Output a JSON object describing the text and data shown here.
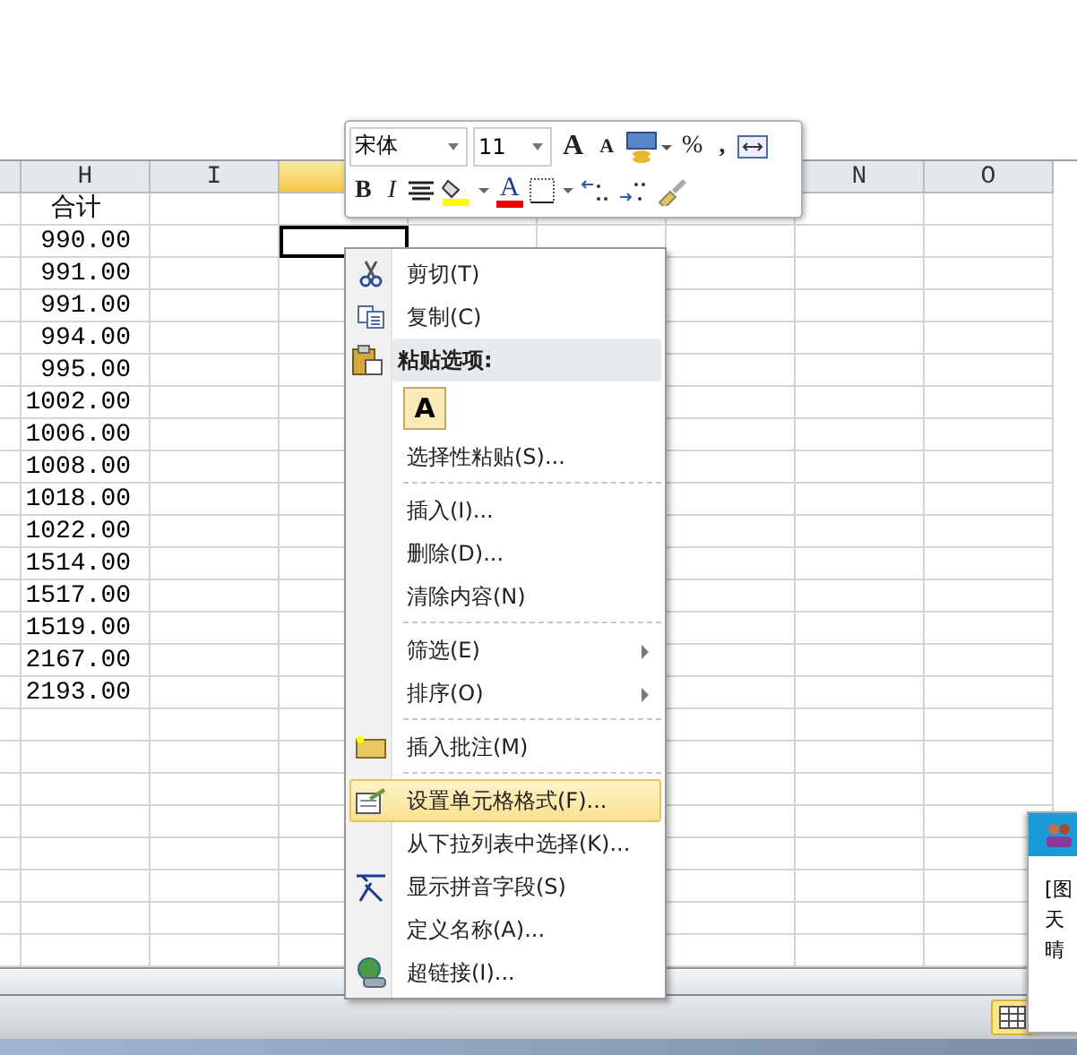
{
  "columns": [
    {
      "label": "H",
      "selected": false
    },
    {
      "label": "I",
      "selected": false
    },
    {
      "selected": true
    },
    {
      "label": "N",
      "selected": false
    },
    {
      "label": "O",
      "selected": false
    }
  ],
  "rows": [
    {
      "h": "合计",
      "selected": false
    },
    {
      "h": "990.00",
      "selected": true
    },
    {
      "h": "991.00",
      "selected": false
    },
    {
      "h": "991.00",
      "selected": false
    },
    {
      "h": "994.00",
      "selected": false
    },
    {
      "h": "995.00",
      "selected": false
    },
    {
      "h": "1002.00",
      "selected": false
    },
    {
      "h": "1006.00",
      "selected": false
    },
    {
      "h": "1008.00",
      "selected": false
    },
    {
      "h": "1018.00",
      "selected": false
    },
    {
      "h": "1022.00",
      "selected": false
    },
    {
      "h": "1514.00",
      "selected": false
    },
    {
      "h": "1517.00",
      "selected": false
    },
    {
      "h": "1519.00",
      "selected": false
    },
    {
      "h": "2167.00",
      "selected": false
    },
    {
      "h": "2193.00",
      "selected": false
    }
  ],
  "mini_toolbar": {
    "font_name": "宋体",
    "font_size": "11",
    "grow_label": "A",
    "shrink_label": "A",
    "percent_label": "%",
    "comma_label": ",",
    "bold_label": "B",
    "italic_label": "I",
    "font_color_label": "A"
  },
  "context_menu": [
    {
      "kind": "item",
      "label": "剪切(T)",
      "submenu": false,
      "selected": false
    },
    {
      "kind": "item",
      "label": "复制(C)",
      "submenu": false,
      "selected": false
    },
    {
      "kind": "header",
      "label": "粘贴选项:"
    },
    {
      "kind": "paste",
      "label": "A"
    },
    {
      "kind": "item",
      "label": "选择性粘贴(S)...",
      "submenu": false,
      "selected": false,
      "separator": true
    },
    {
      "kind": "item",
      "label": "插入(I)...",
      "submenu": false,
      "selected": false
    },
    {
      "kind": "item",
      "label": "删除(D)...",
      "submenu": false,
      "selected": false
    },
    {
      "kind": "item",
      "label": "清除内容(N)",
      "submenu": false,
      "selected": false,
      "separator": true
    },
    {
      "kind": "item",
      "label": "筛选(E)",
      "submenu": true,
      "selected": false
    },
    {
      "kind": "item",
      "label": "排序(O)",
      "submenu": true,
      "selected": false,
      "separator": true
    },
    {
      "kind": "item",
      "label": "插入批注(M)",
      "submenu": false,
      "selected": false,
      "separator": true
    },
    {
      "kind": "item",
      "label": "设置单元格格式(F)...",
      "submenu": false,
      "selected": true
    },
    {
      "kind": "item",
      "label": "从下拉列表中选择(K)...",
      "submenu": false,
      "selected": false
    },
    {
      "kind": "item",
      "label": "显示拼音字段(S)",
      "submenu": false,
      "selected": false
    },
    {
      "kind": "item",
      "label": "定义名称(A)...",
      "submenu": false,
      "selected": false
    },
    {
      "kind": "item",
      "label": "超链接(I)...",
      "submenu": false,
      "selected": false
    }
  ],
  "notification": {
    "lines": [
      "[图",
      "天",
      "晴"
    ]
  }
}
